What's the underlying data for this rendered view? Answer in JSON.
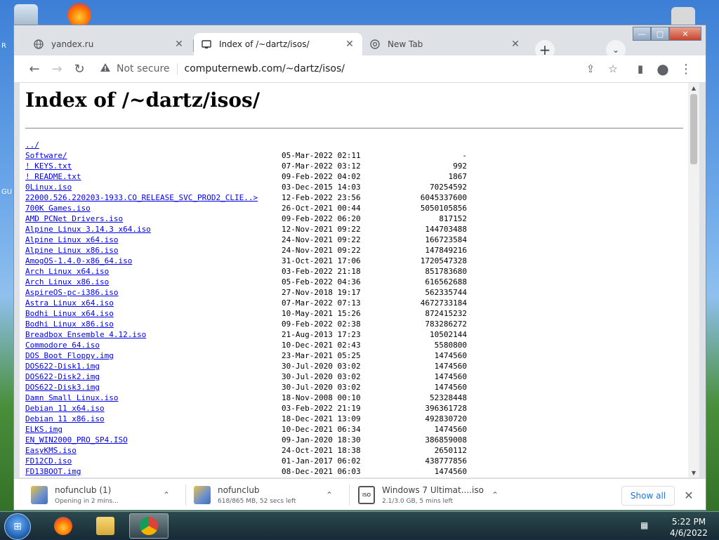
{
  "desktop": {
    "left_labels": [
      "R",
      "GU"
    ]
  },
  "window": {
    "min": "—",
    "max": "□",
    "close": "✕"
  },
  "tabs": [
    {
      "label": "yandex.ru",
      "close": "✕"
    },
    {
      "label": "Index of /~dartz/isos/",
      "close": "✕"
    },
    {
      "label": "New Tab",
      "close": "✕"
    }
  ],
  "tabstrip": {
    "new_tab": "+",
    "tab_search": "⌄"
  },
  "toolbar": {
    "back": "←",
    "forward": "→",
    "reload": "↻",
    "security_text": "Not secure",
    "url": "computernewb.com/~dartz/isos/",
    "share": "⇪",
    "bookmark": "☆",
    "sidebar": "▮",
    "profile": "●",
    "menu": "⋮"
  },
  "page": {
    "title": "Index of /~dartz/isos/",
    "parent_link": "../",
    "entries": [
      {
        "name": "Software/",
        "date": "05-Mar-2022 02:11",
        "size": "-"
      },
      {
        "name": "! KEYS.txt",
        "date": "07-Mar-2022 03:12",
        "size": "992"
      },
      {
        "name": "! README.txt",
        "date": "09-Feb-2022 04:02",
        "size": "1867"
      },
      {
        "name": "0Linux.iso",
        "date": "03-Dec-2015 14:03",
        "size": "70254592"
      },
      {
        "name": "22000.526.220203-1933.CO_RELEASE_SVC_PROD2_CLIE..>",
        "date": "12-Feb-2022 23:56",
        "size": "6045337600"
      },
      {
        "name": "700K Games.iso",
        "date": "26-Oct-2021 00:44",
        "size": "5050105856"
      },
      {
        "name": "AMD PCNet Drivers.iso",
        "date": "09-Feb-2022 06:20",
        "size": "817152"
      },
      {
        "name": "Alpine Linux 3.14.3 x64.iso",
        "date": "12-Nov-2021 09:22",
        "size": "144703488"
      },
      {
        "name": "Alpine Linux x64.iso",
        "date": "24-Nov-2021 09:22",
        "size": "166723584"
      },
      {
        "name": "Alpine Linux x86.iso",
        "date": "24-Nov-2021 09:22",
        "size": "147849216"
      },
      {
        "name": "AmogOS-1.4.0-x86_64.iso",
        "date": "31-Oct-2021 17:06",
        "size": "1720547328"
      },
      {
        "name": "Arch Linux x64.iso",
        "date": "03-Feb-2022 21:18",
        "size": "851783680"
      },
      {
        "name": "Arch Linux x86.iso",
        "date": "05-Feb-2022 04:36",
        "size": "616562688"
      },
      {
        "name": "AspireOS-pc-i386.iso",
        "date": "27-Nov-2018 19:17",
        "size": "562335744"
      },
      {
        "name": "Astra Linux x64.iso",
        "date": "07-Mar-2022 07:13",
        "size": "4672733184"
      },
      {
        "name": "Bodhi Linux x64.iso",
        "date": "10-May-2021 15:26",
        "size": "872415232"
      },
      {
        "name": "Bodhi Linux x86.iso",
        "date": "09-Feb-2022 02:38",
        "size": "783286272"
      },
      {
        "name": "Breadbox Ensemble 4.12.iso",
        "date": "21-Aug-2013 17:23",
        "size": "10502144"
      },
      {
        "name": "Commodore 64.iso",
        "date": "10-Dec-2021 02:43",
        "size": "5580800"
      },
      {
        "name": "DOS Boot Floppy.img",
        "date": "23-Mar-2021 05:25",
        "size": "1474560"
      },
      {
        "name": "DOS622-Disk1.img",
        "date": "30-Jul-2020 03:02",
        "size": "1474560"
      },
      {
        "name": "DOS622-Disk2.img",
        "date": "30-Jul-2020 03:02",
        "size": "1474560"
      },
      {
        "name": "DOS622-Disk3.img",
        "date": "30-Jul-2020 03:02",
        "size": "1474560"
      },
      {
        "name": "Damn Small Linux.iso",
        "date": "18-Nov-2008 00:10",
        "size": "52328448"
      },
      {
        "name": "Debian 11 x64.iso",
        "date": "03-Feb-2022 21:19",
        "size": "396361728"
      },
      {
        "name": "Debian 11 x86.iso",
        "date": "18-Dec-2021 13:09",
        "size": "492830720"
      },
      {
        "name": "ELKS.img",
        "date": "10-Dec-2021 06:34",
        "size": "1474560"
      },
      {
        "name": "EN_WIN2000_PRO_SP4.ISO",
        "date": "09-Jan-2020 18:30",
        "size": "386859008"
      },
      {
        "name": "EasyKMS.iso",
        "date": "24-Oct-2021 18:38",
        "size": "2650112"
      },
      {
        "name": "FD12CD.iso",
        "date": "01-Jan-2017 06:02",
        "size": "438777856"
      },
      {
        "name": "FD13BOOT.img",
        "date": "08-Dec-2021 06:03",
        "size": "1474560"
      }
    ]
  },
  "downloads": {
    "items": [
      {
        "name": "nofunclub (1)",
        "status": "Opening in 2 mins..."
      },
      {
        "name": "nofunclub",
        "status": "618/865 MB, 52 secs left"
      },
      {
        "name": "Windows 7 Ultimat....iso",
        "status": "2.1/3.0 GB, 5 mins left"
      }
    ],
    "chevron": "⌃",
    "show_all": "Show all",
    "close": "✕"
  },
  "taskbar": {
    "start": "⊞",
    "time": "5:22 PM",
    "date": "4/6/2022"
  },
  "colors": {
    "link": "#0000ee",
    "accent": "#1a73e8"
  }
}
